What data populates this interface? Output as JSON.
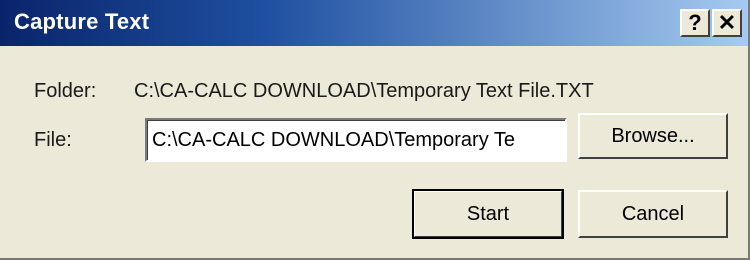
{
  "window": {
    "title": "Capture Text"
  },
  "titlebar_buttons": {
    "help": "?",
    "close": "✕"
  },
  "folder": {
    "label": "Folder:",
    "value": "C:\\CA-CALC DOWNLOAD\\Temporary Text File.TXT"
  },
  "file": {
    "label": "File:",
    "value": "C:\\CA-CALC DOWNLOAD\\Temporary Te"
  },
  "buttons": {
    "browse": "Browse...",
    "start": "Start",
    "cancel": "Cancel"
  },
  "colors": {
    "title_start": "#0a246a",
    "title_end": "#a6caf0",
    "dialog_bg": "#ece9d8"
  },
  "icons": {
    "help": "help-icon",
    "close": "close-icon"
  }
}
